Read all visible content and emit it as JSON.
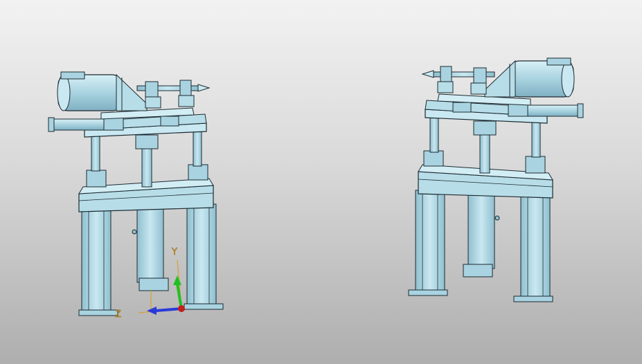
{
  "viewport": {
    "background_top": "#f2f2f2",
    "background_bottom": "#aeaeae"
  },
  "model": {
    "part_color": "#b7dde8",
    "part_shade": "#8fbfcf",
    "edge_color": "#1c2a30",
    "instances": [
      "model-left",
      "model-right-mirrored"
    ]
  },
  "triad": {
    "y_label": "Y",
    "z_label": "Z",
    "y_color": "#22c022",
    "z_color": "#2a3ad8",
    "x_color": "#c02020",
    "label_color": "#e0a020"
  }
}
